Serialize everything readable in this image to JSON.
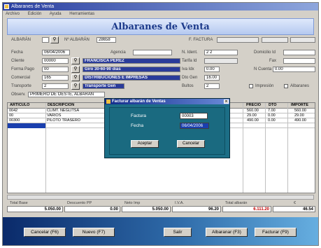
{
  "window": {
    "title": "Albaranes de Venta"
  },
  "menubar": {
    "items": [
      "Archivo",
      "Edición",
      "Ayuda",
      "Herramientas"
    ]
  },
  "header": {
    "title": "Albaranes de Venta"
  },
  "top": {
    "albaran_label": "ALBARÁN",
    "albaran_value": "",
    "n_albaran_label": "Nº ALBARÁN",
    "n_albaran_value": "28658",
    "f_label": "F. FACTURA",
    "f_value": ""
  },
  "fields": {
    "fecha_label": "Fecha",
    "fecha_value": "06/04/2006",
    "cliente_label": "Cliente",
    "cliente_code": "00000",
    "cliente_name": "FRANCISCA PÉREZ",
    "forma_pago_label": "Forma Pago",
    "forma_pago_code": "00",
    "forma_pago_name": "Giro 30-60-90 días",
    "comercial_label": "Comercial",
    "comercial_code": "165",
    "comercial_name": "DISTRIBUCIONES E IMPRESAS",
    "transporte_label": "Transporte",
    "transporte_code": "2",
    "transporte_name": "Transporte Gen",
    "observ_label": "Observ.",
    "observ_value": "PRIMERO DE OESTE, ALBARÁN",
    "agencia_label": "Agencia",
    "n_ident_label": "N. Ident.",
    "n_ident_value": "2  2",
    "tarifa_label": "Tarifa Id",
    "iva_label": "Iva Idx",
    "iva_value": "0.00",
    "dto_label": "Dto Gen",
    "dto_value": "16.00",
    "bultos_label": "Bultos",
    "bultos_value": "2",
    "domicilio_label": "Domicilio Id",
    "fax_label": "Fax",
    "cuenta_label": "N Cuenta",
    "cuenta_value": "0.00",
    "impr_label": "Impresión",
    "albaranes_label": "Albaranes"
  },
  "grid": {
    "columns": [
      "ARTÍCULO",
      "DESCRIPCIÓN",
      "PRECIO",
      "DTO",
      "IMPORTE"
    ],
    "rows": [
      [
        "0042",
        "CLIMT. NEGLITSA",
        "560.00",
        "7.00",
        "560.00"
      ],
      [
        "00",
        "VARIOS",
        "29.00",
        "0.00",
        "29.00"
      ],
      [
        "00300",
        "PILOTO TRASERO",
        "490.00",
        "0.00",
        "490.00"
      ],
      [
        "",
        "",
        "",
        "",
        ""
      ]
    ]
  },
  "totals": {
    "base_label": "Total Base",
    "base_value": "5.050.00",
    "desc_label": "Descuento PP",
    "desc_value": "0.00",
    "neto_label": "Neto Imp",
    "neto_value": "5.050.00",
    "iva_label": "I.V.A.",
    "iva_value": "96.20",
    "total_label": "Total albarán",
    "total_value": "6.111.20",
    "last_label": "€",
    "last_value": "46.54"
  },
  "buttons": {
    "cancel": "Cancelar (F6)",
    "new": "Nuevo (F7)",
    "exit": "Salir",
    "open": "Albaranar (F3)",
    "print": "Facturar (F9)"
  },
  "dialog": {
    "title": "Facturar albarán de Ventas",
    "factura_label": "Factura",
    "factura_value": "00003",
    "fecha_label": "Fecha",
    "fecha_value": "06/04/2006",
    "accept": "Aceptar",
    "cancel": "Cancelar"
  }
}
